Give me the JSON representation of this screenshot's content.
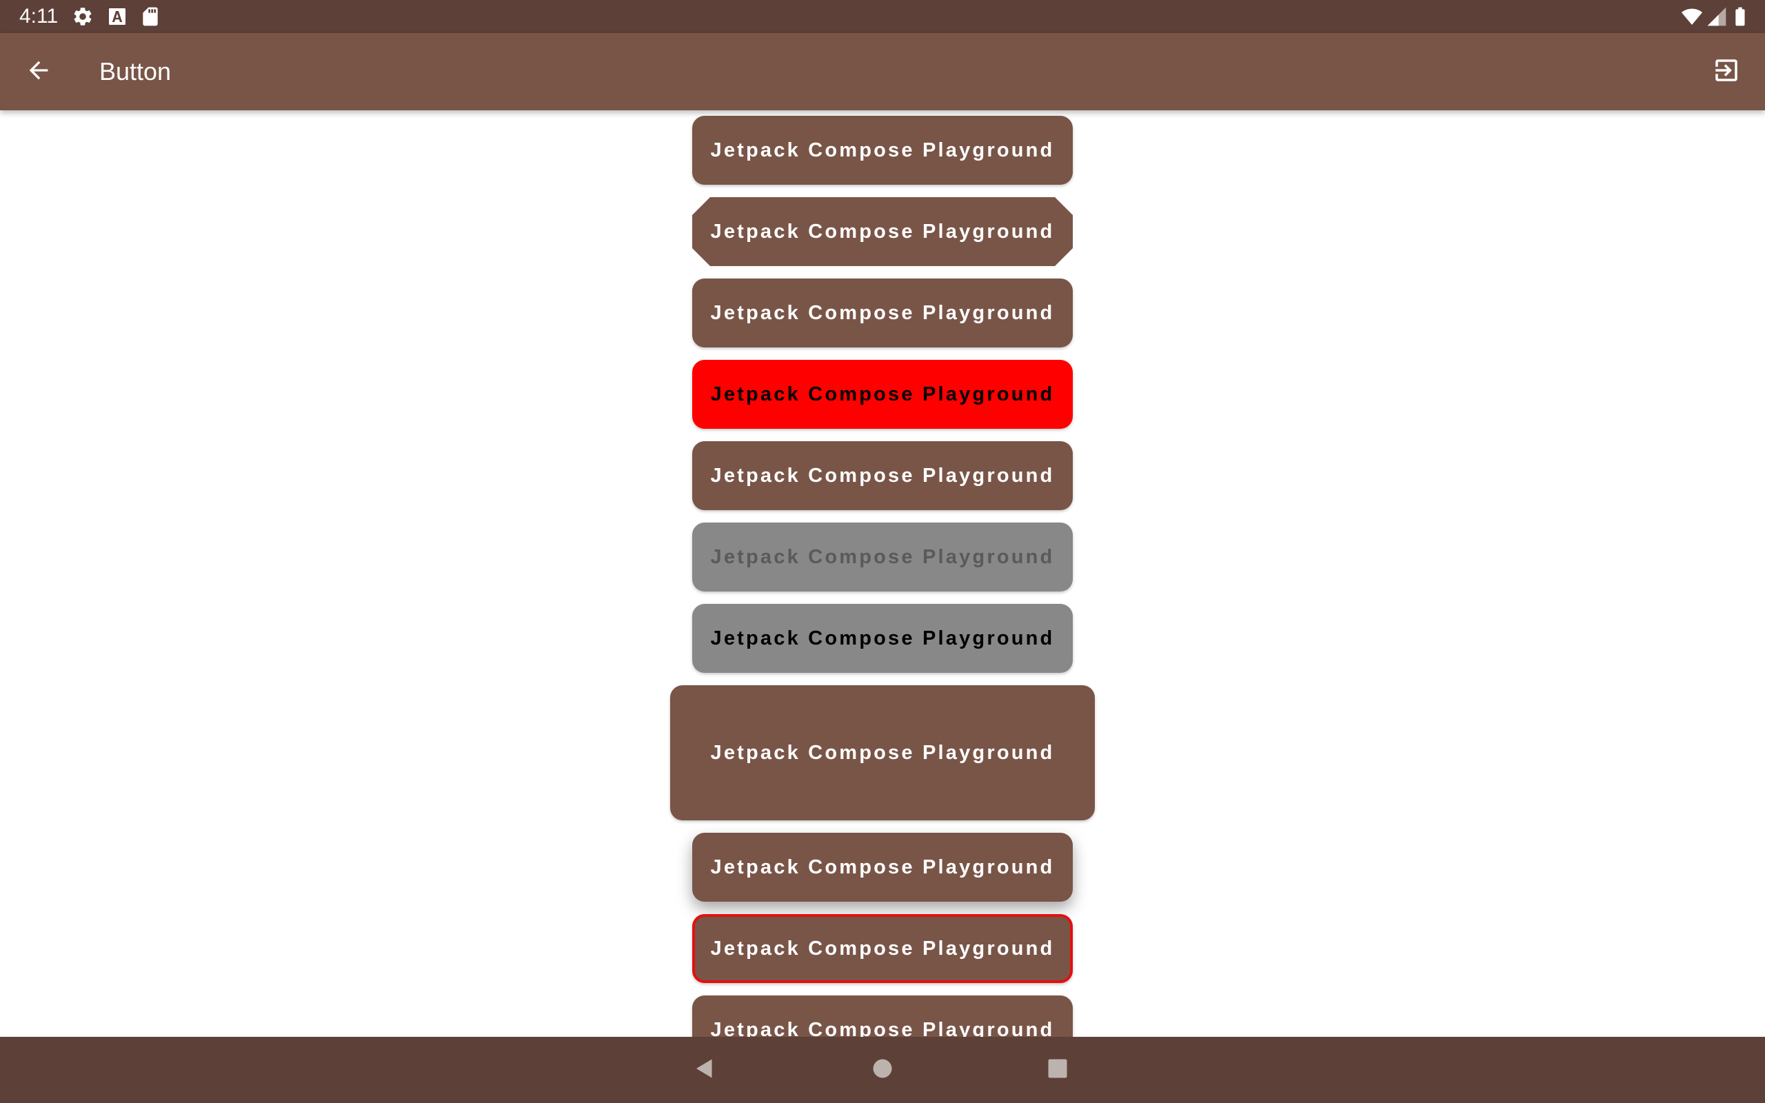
{
  "status_bar": {
    "time": "4:11",
    "icons": [
      "gear-icon",
      "text-a-icon",
      "sd-card-icon",
      "wifi-icon",
      "signal-icon",
      "battery-icon"
    ]
  },
  "app_bar": {
    "title": "Button",
    "back_icon": "arrow-back-icon",
    "action_icon": "exit-to-app-icon"
  },
  "buttons": [
    {
      "label": "Jetpack Compose Playground",
      "style": "rounded",
      "background": "#795548",
      "text_color": "#ffffff"
    },
    {
      "label": "Jetpack Compose Playground",
      "style": "cut-corner",
      "background": "#795548",
      "text_color": "#ffffff"
    },
    {
      "label": "Jetpack Compose Playground",
      "style": "rounded",
      "background": "#795548",
      "text_color": "#ffffff"
    },
    {
      "label": "Jetpack Compose Playground",
      "style": "red-background",
      "background": "#ff0000",
      "text_color": "#000000"
    },
    {
      "label": "Jetpack Compose Playground",
      "style": "rounded",
      "background": "#795548",
      "text_color": "#ffffff"
    },
    {
      "label": "Jetpack Compose Playground",
      "style": "disabled",
      "background": "#888888",
      "text_color": "#5a5a5a"
    },
    {
      "label": "Jetpack Compose Playground",
      "style": "grey",
      "background": "#888888",
      "text_color": "#000000"
    },
    {
      "label": "Jetpack Compose Playground",
      "style": "large-padding",
      "background": "#795548",
      "text_color": "#ffffff"
    },
    {
      "label": "Jetpack Compose Playground",
      "style": "elevated",
      "background": "#795548",
      "text_color": "#ffffff"
    },
    {
      "label": "Jetpack Compose Playground",
      "style": "outlined-red-border",
      "background": "#795548",
      "text_color": "#ffffff",
      "border_color": "#e31010"
    },
    {
      "label": "Jetpack Compose Playground",
      "style": "rounded-partially-visible",
      "background": "#795548",
      "text_color": "#ffffff"
    }
  ],
  "nav_bar": {
    "icons": [
      "nav-back-icon",
      "nav-home-icon",
      "nav-recents-icon"
    ]
  },
  "colors": {
    "status_bar": "#5d4037",
    "app_bar": "#795548",
    "primary": "#795548",
    "background": "#ffffff"
  }
}
